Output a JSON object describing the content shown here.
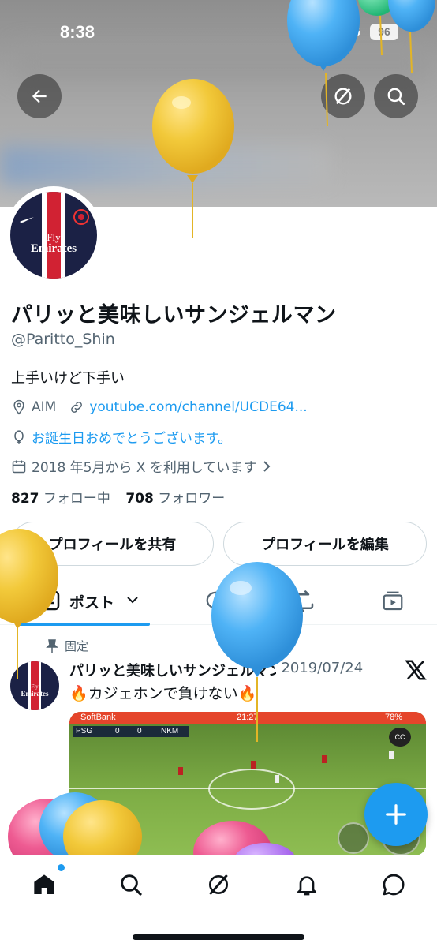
{
  "status_bar": {
    "time": "8:38",
    "network": "4G",
    "battery": "96"
  },
  "header": {
    "back_icon": "arrow-left-icon",
    "grok_icon": "grok-icon",
    "search_icon": "search-icon"
  },
  "profile": {
    "name": "パリッと美味しいサンジェルマン",
    "handle": "@Paritto_Shin",
    "bio": "上手いけど下手い",
    "location": "AIM",
    "website": "youtube.com/channel/UCDE64...",
    "birthday": "お誕生日おめでとうございます。",
    "joined": "2018 年5月から X を利用しています",
    "following_count": "827",
    "following_label": "フォロー中",
    "followers_count": "708",
    "followers_label": "フォロワー",
    "avatar_text": {
      "line1": "Fly",
      "line2": "Emirates"
    }
  },
  "actions": {
    "share_label": "プロフィールを共有",
    "edit_label": "プロフィールを編集"
  },
  "tabs": {
    "posts_label": "ポスト"
  },
  "pinned_post": {
    "pinned_label": "固定",
    "author": "パリッと美味しいサンジェルマン",
    "date": "· 2019/07/24",
    "text": "🔥カジェホンで負けない🔥",
    "media": {
      "carrier": "SoftBank",
      "time": "21:27",
      "battery": "78%",
      "home_team": "PSG",
      "home_score": "0",
      "away_score": "0",
      "away_team": "NKM"
    }
  },
  "bottom_nav": [
    "home-icon",
    "search-icon",
    "grok-icon",
    "bell-icon",
    "messages-icon"
  ],
  "colors": {
    "accent": "#1d9bf0",
    "text": "#0f1419",
    "secondary": "#536471",
    "avatar_bg": "#1b2145"
  }
}
